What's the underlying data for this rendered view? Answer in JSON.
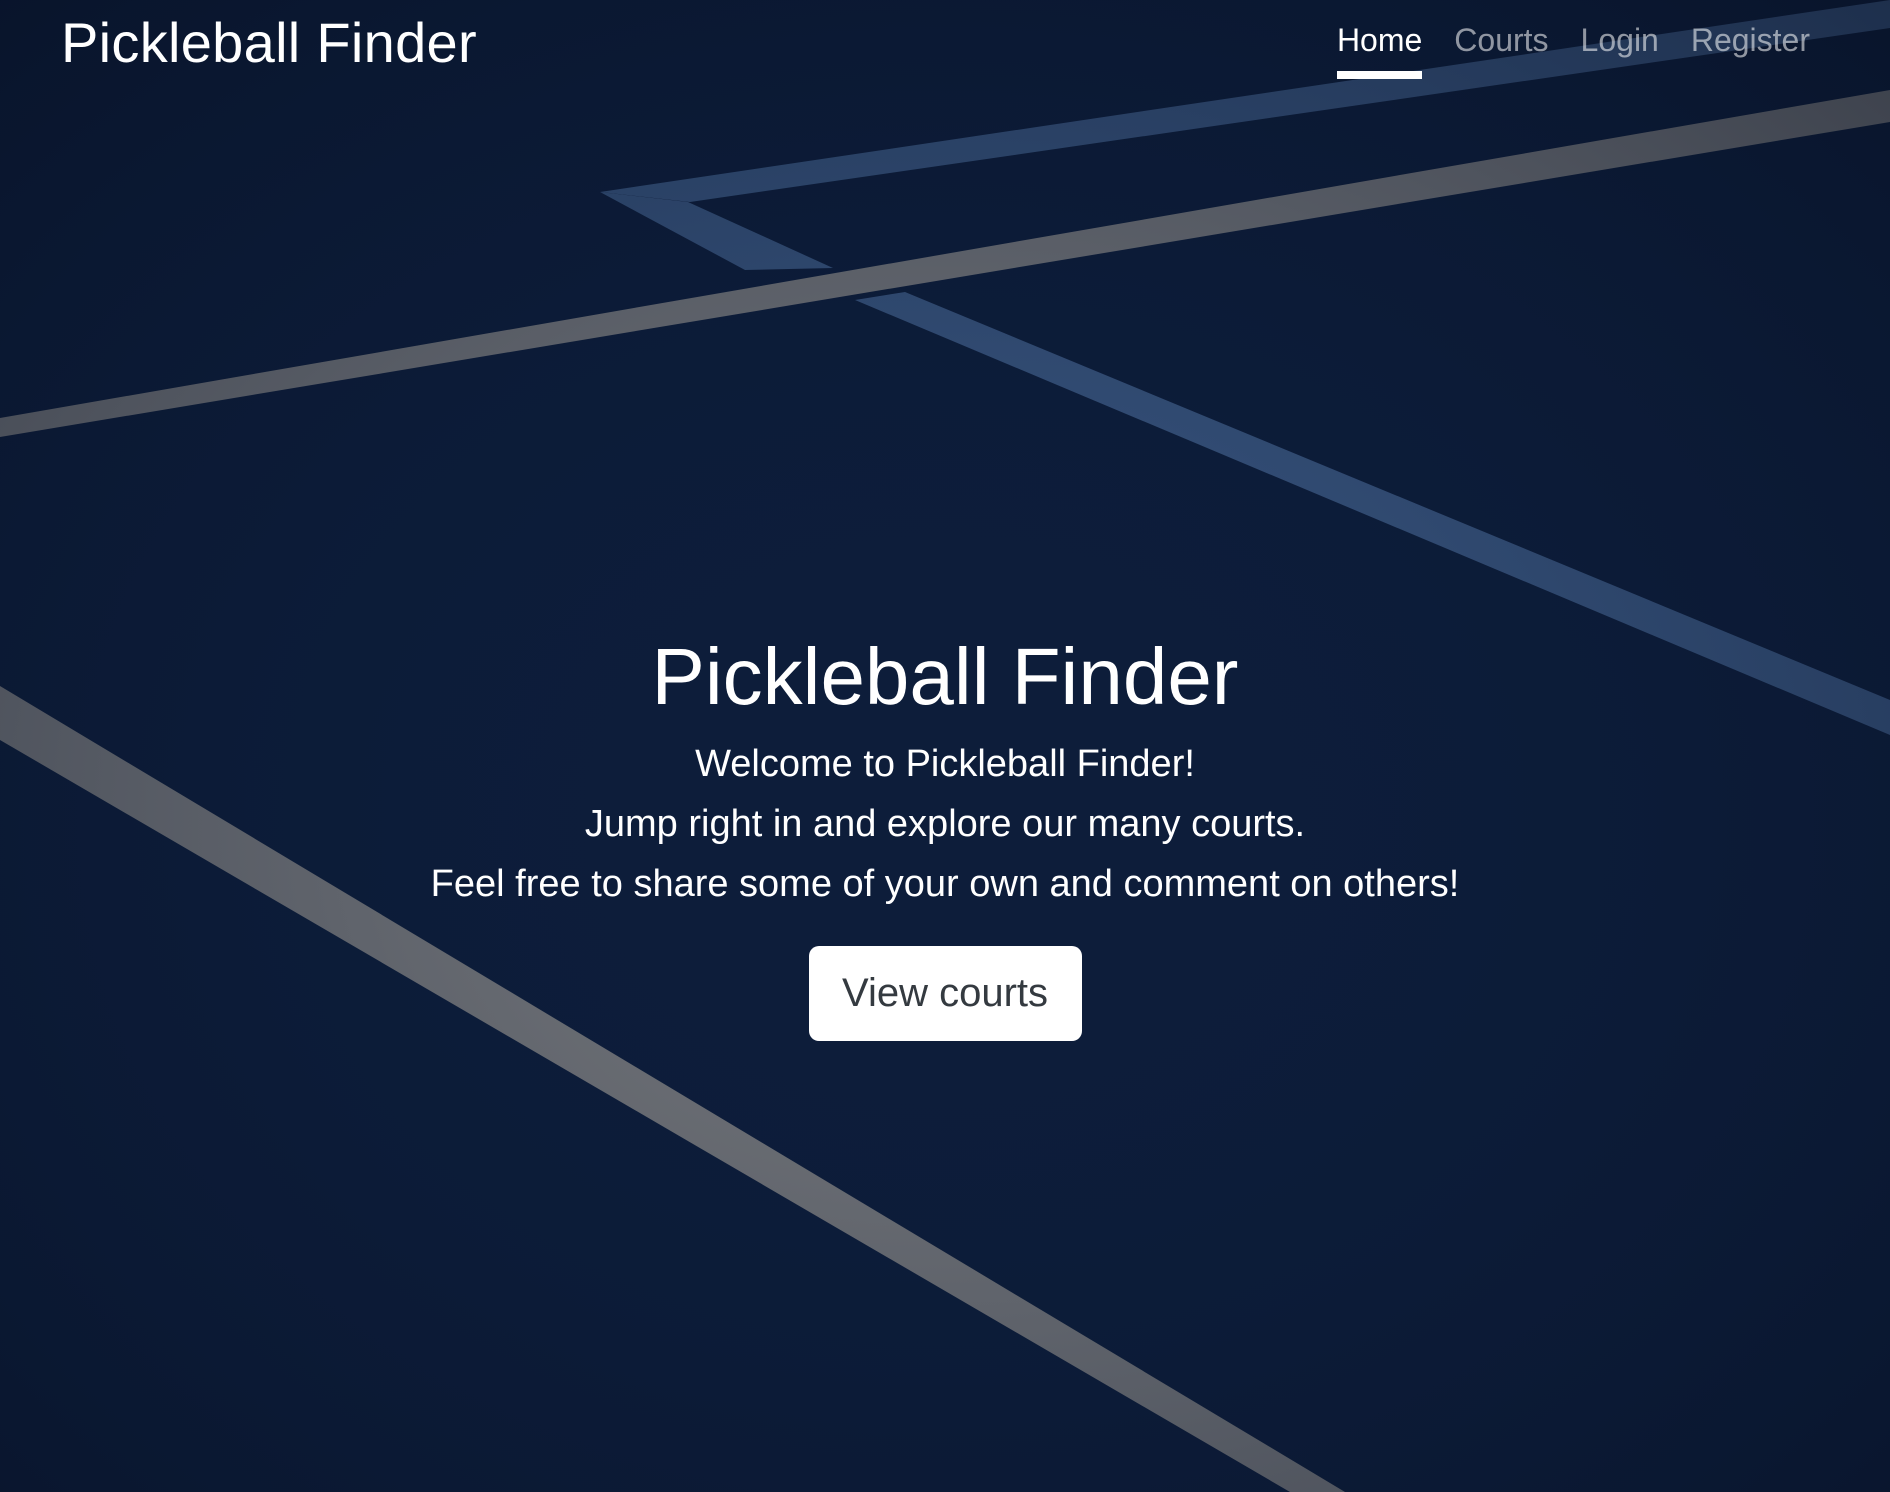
{
  "colors": {
    "court_blue": "#0d1d3a",
    "line_gray": "#7a7b7d",
    "line_blue": "#3b5882",
    "button_bg": "#ffffff",
    "button_text": "#343a40"
  },
  "header": {
    "brand": "Pickleball Finder",
    "nav": [
      {
        "label": "Home",
        "active": true
      },
      {
        "label": "Courts",
        "active": false
      },
      {
        "label": "Login",
        "active": false
      },
      {
        "label": "Register",
        "active": false
      }
    ]
  },
  "hero": {
    "title": "Pickleball Finder",
    "lines": [
      "Welcome to Pickleball Finder!",
      "Jump right in and explore our many courts.",
      "Feel free to share some of your own and comment on others!"
    ],
    "button_label": "View courts"
  }
}
